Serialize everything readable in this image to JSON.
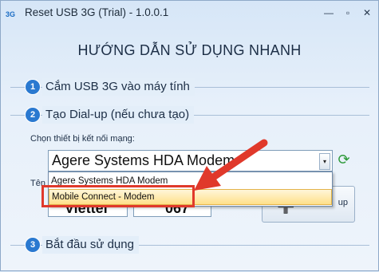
{
  "window": {
    "app_icon_text": "3G",
    "title": "Reset USB 3G (Trial) - 1.0.0.1",
    "minimize": "—",
    "maximize": "▫",
    "close": "✕"
  },
  "heading": "HƯỚNG DẪN SỬ DỤNG NHANH",
  "steps": [
    {
      "number": "1",
      "label": "Cắm USB 3G vào máy tính"
    },
    {
      "number": "2",
      "label": "Tạo Dial-up (nếu chưa tạo)"
    },
    {
      "number": "3",
      "label": "Bắt đầu sử dụng"
    }
  ],
  "device": {
    "label": "Chọn thiết bị kết nối mạng:",
    "selected": "Agere Systems HDA Modem",
    "arrow_icon": "▾",
    "refresh_icon": "⟳",
    "options": [
      "Agere Systems HDA Modem",
      "Mobile Connect - Modem"
    ],
    "highlighted_option": "Mobile Connect - Modem"
  },
  "partial": {
    "label": "Tên",
    "username_value": "Viettel",
    "password_value": "‘067'",
    "side_button_icon": "➕",
    "side_button_text": "up"
  },
  "colors": {
    "accent": "#2a79d0",
    "annotation": "#e0392b",
    "highlight_bg": "#ffe08a"
  }
}
